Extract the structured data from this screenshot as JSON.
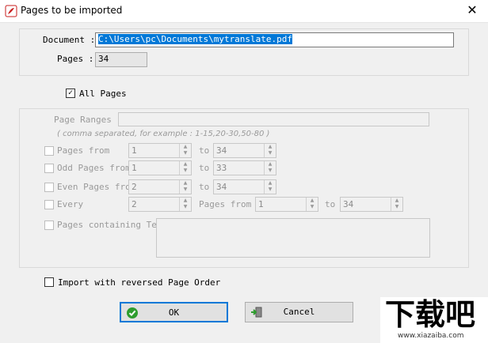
{
  "window": {
    "title": "Pages to be imported",
    "close_glyph": "✕"
  },
  "document": {
    "label": "Document :",
    "path": "C:\\Users\\pc\\Documents\\mytranslate.pdf"
  },
  "pages": {
    "label": "Pages :",
    "count": "34"
  },
  "all_pages": {
    "label": "All Pages",
    "checked": true
  },
  "page_ranges": {
    "label": "Page Ranges :",
    "hint": "( comma separated, for example : 1-15,20-30,50-80 )",
    "value": ""
  },
  "rows": {
    "pages_from": {
      "label": "Pages from",
      "from": "1",
      "to_label": "to",
      "to": "34"
    },
    "odd_pages": {
      "label": "Odd Pages from",
      "from": "1",
      "to_label": "to",
      "to": "33"
    },
    "even_pages": {
      "label": "Even Pages from",
      "from": "2",
      "to_label": "to",
      "to": "34"
    },
    "every": {
      "label": "Every",
      "value": "2",
      "pages_from_label": "Pages from",
      "from": "1",
      "to_label": "to",
      "to": "34"
    },
    "containing_text": {
      "label": "Pages containing Text",
      "value": ""
    }
  },
  "reverse": {
    "label": "Import with reversed Page Order",
    "checked": false
  },
  "buttons": {
    "ok": "OK",
    "cancel": "Cancel"
  },
  "watermark": {
    "brand": "下载吧",
    "url": "www.xiazaiba.com"
  },
  "colors": {
    "selection": "#0078d7",
    "ok_icon": "#2e9d2e",
    "app_icon": "#c81e1e"
  }
}
